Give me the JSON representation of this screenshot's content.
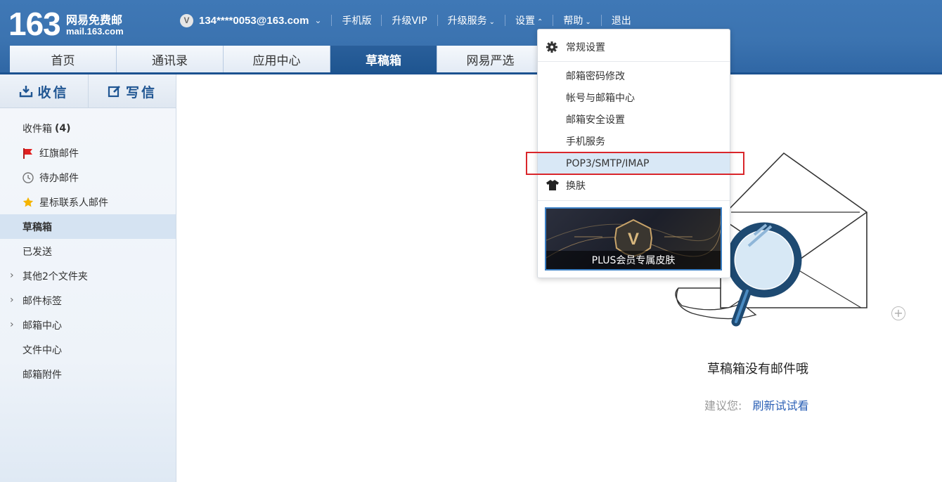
{
  "header": {
    "logo_number": "163",
    "logo_cn": "网易免费邮",
    "logo_en": "mail.163.com",
    "vip_badge": "V",
    "account": "134****0053@163.com",
    "nav": [
      "手机版",
      "升级VIP",
      "升级服务",
      "设置",
      "帮助",
      "退出"
    ]
  },
  "tabs": {
    "items": [
      "首页",
      "通讯录",
      "应用中心",
      "草稿箱",
      "网易严选"
    ],
    "active": "草稿箱",
    "close_symbol": "×"
  },
  "sidebar": {
    "receive_label": "收信",
    "write_label": "写信",
    "folders": [
      {
        "label": "收件箱",
        "count": "(4)"
      },
      {
        "label": "红旗邮件"
      },
      {
        "label": "待办邮件"
      },
      {
        "label": "星标联系人邮件"
      },
      {
        "label": "草稿箱",
        "active": true
      },
      {
        "label": "已发送"
      },
      {
        "label": "其他2个文件夹",
        "expandable": true
      },
      {
        "label": "邮件标签",
        "expandable": true
      },
      {
        "label": "邮箱中心",
        "expandable": true
      },
      {
        "label": "文件中心"
      },
      {
        "label": "邮箱附件"
      }
    ]
  },
  "settings_menu": {
    "header": "常规设置",
    "items": [
      "邮箱密码修改",
      "帐号与邮箱中心",
      "邮箱安全设置",
      "手机服务",
      "POP3/SMTP/IMAP",
      "换肤"
    ],
    "highlighted": "POP3/SMTP/IMAP",
    "skin_badge": "V",
    "skin_card_label": "PLUS会员专属皮肤"
  },
  "empty_state": {
    "title": "草稿箱没有邮件哦",
    "hint": "建议您:",
    "refresh_link": "刷新试试看"
  },
  "colors": {
    "header_blue": "#3b73b0",
    "active_tab": "#1e5590",
    "link_blue": "#2a5fb5",
    "highlight_red": "#d9262b"
  }
}
